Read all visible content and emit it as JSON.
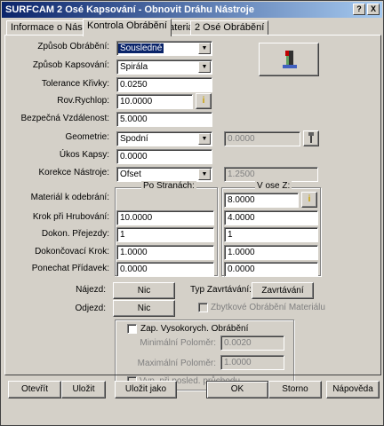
{
  "window": {
    "title": "SURFCAM 2 Osé Kapsování - Obnovit Dráhu Nástroje",
    "help_label": "?",
    "close_label": "X"
  },
  "tabs": [
    {
      "label": "Informace o Nástroji",
      "active": false
    },
    {
      "label": "Kontrola Obrábění",
      "active": true
    },
    {
      "label": "Materiál",
      "active": false
    },
    {
      "label": "2 Osé Obrábění",
      "active": false
    }
  ],
  "form": {
    "zpusob_obrabeni": {
      "label": "Způsob Obrábění:",
      "value": "Sousledné"
    },
    "zpusob_kapsovani": {
      "label": "Způsob Kapsování:",
      "value": "Spirála"
    },
    "tolerance_krivky": {
      "label": "Tolerance Křivky:",
      "value": "0.0250"
    },
    "rov_rychlop": {
      "label": "Rov.Rychlop:",
      "value": "10.0000"
    },
    "bezpecna_vzdalenost": {
      "label": "Bezpečná Vzdálenost:",
      "value": "5.0000"
    },
    "geometrie": {
      "label": "Geometrie:",
      "value": "Spodní",
      "extra_value": "0.0000"
    },
    "ukos_kapsy": {
      "label": "Úkos Kapsy:",
      "value": "0.0000"
    },
    "korekce_nastroje": {
      "label": "Korekce Nástroje:",
      "value": "Ofset",
      "extra_value": "1.2500"
    }
  },
  "table": {
    "col_headers": [
      "Po Stranách:",
      "V ose Z:"
    ],
    "rows": [
      {
        "label": "Materiál k odebrání:",
        "side": "",
        "z": "8.0000"
      },
      {
        "label": "Krok při Hrubování:",
        "side": "10.0000",
        "z": "4.0000"
      },
      {
        "label": "Dokon. Přejezdy:",
        "side": "1",
        "z": "1"
      },
      {
        "label": "Dokončovací Krok:",
        "side": "1.0000",
        "z": "1.0000"
      },
      {
        "label": "Ponechat Přídavek:",
        "side": "0.0000",
        "z": "0.0000"
      }
    ]
  },
  "entry": {
    "najezd_label": "Nájezd:",
    "najezd_btn": "Nic",
    "odjezd_label": "Odjezd:",
    "odjezd_btn": "Nic"
  },
  "zavrtavani": {
    "label": "Typ Zavrtávání:",
    "btn": "Zavrtávání",
    "zbytkove": "Zbytkové Obrábění Materiálu"
  },
  "vysokorych": {
    "title": "Zap. Vysokorych. Obrábění",
    "min_label": "Minimální Poloměr:",
    "min_value": "0.0020",
    "max_label": "Maximální Poloměr:",
    "max_value": "1.0000",
    "posledni": "Vyp. při posled. průchodu"
  },
  "footer": {
    "otevrit": "Otevřít",
    "ulozit": "Uložit",
    "ulozit_jako": "Uložit jako",
    "ok": "OK",
    "storno": "Storno",
    "napoveda": "Nápověda"
  },
  "icons": [
    "info-icon",
    "tool-preview-icon",
    "pin-icon",
    "dropdown-arrow-icon"
  ]
}
